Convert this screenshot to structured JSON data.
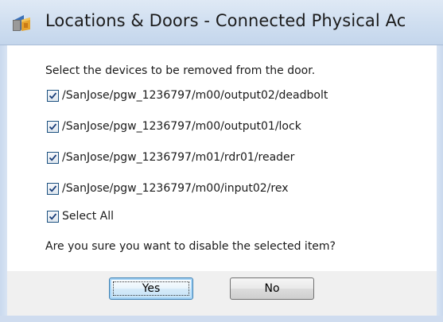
{
  "window": {
    "title": "Locations & Doors - Connected Physical Ac",
    "icon": "app-icon"
  },
  "dialog": {
    "prompt": "Select the devices to be removed from the door.",
    "devices": [
      {
        "label": "/SanJose/pgw_1236797/m00/output02/deadbolt",
        "checked": true
      },
      {
        "label": "/SanJose/pgw_1236797/m00/output01/lock",
        "checked": true
      },
      {
        "label": "/SanJose/pgw_1236797/m01/rdr01/reader",
        "checked": true
      },
      {
        "label": "/SanJose/pgw_1236797/m00/input02/rex",
        "checked": true
      }
    ],
    "select_all": {
      "label": "Select All",
      "checked": true
    },
    "question": "Are you sure you want to disable the selected item?"
  },
  "buttons": {
    "yes_label": "Yes",
    "no_label": "No"
  },
  "colors": {
    "titlebar": "#cfdef0",
    "checkbox_border": "#1c5180",
    "checkmark": "#1b3f7a",
    "default_button_border": "#3c7fb1"
  }
}
